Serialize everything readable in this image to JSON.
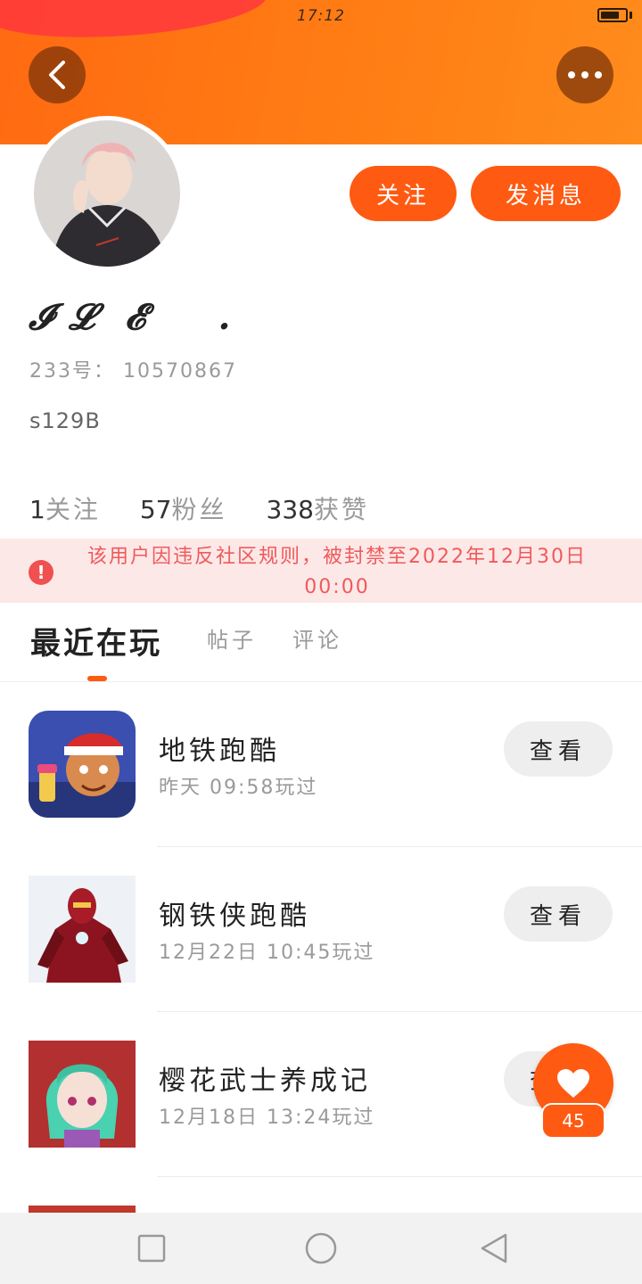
{
  "status_bar": {
    "time": "17:12",
    "battery_level": 0.75
  },
  "header": {
    "back_icon": "chevron-left-icon",
    "more_icon": "more-dots-icon"
  },
  "profile": {
    "username": "𝓘 𝓛  𝓔     .",
    "uid": "233号： 10570867",
    "bio": "s129B",
    "follow_label": "关注",
    "message_label": "发消息",
    "stats": [
      {
        "num": "1",
        "label": "关注"
      },
      {
        "num": "57",
        "label": "粉丝"
      },
      {
        "num": "338",
        "label": "获赞"
      }
    ]
  },
  "ban_notice": {
    "icon": "exclamation-icon",
    "text": "该用户因违反社区规则，被封禁至2022年12月30日 00:00"
  },
  "tabs": [
    "最近在玩",
    "帖子",
    "评论"
  ],
  "games": [
    {
      "name": "地铁跑酷",
      "time": "昨天 09:58玩过",
      "action": "查看"
    },
    {
      "name": "钢铁侠跑酷",
      "time": "12月22日 10:45玩过",
      "action": "查看"
    },
    {
      "name": "樱花武士养成记",
      "time": "12月18日 13:24玩过",
      "action": "查看"
    }
  ],
  "like_fab": {
    "count": "45",
    "icon": "heart-icon"
  },
  "nav_bar": {
    "icons": [
      "square-icon",
      "circle-icon",
      "triangle-back-icon"
    ]
  },
  "colors": {
    "accent": "#ff5a12",
    "header": "#ff7d14",
    "ban_bg": "#fde8e8",
    "ban_text": "#f05a5a"
  }
}
